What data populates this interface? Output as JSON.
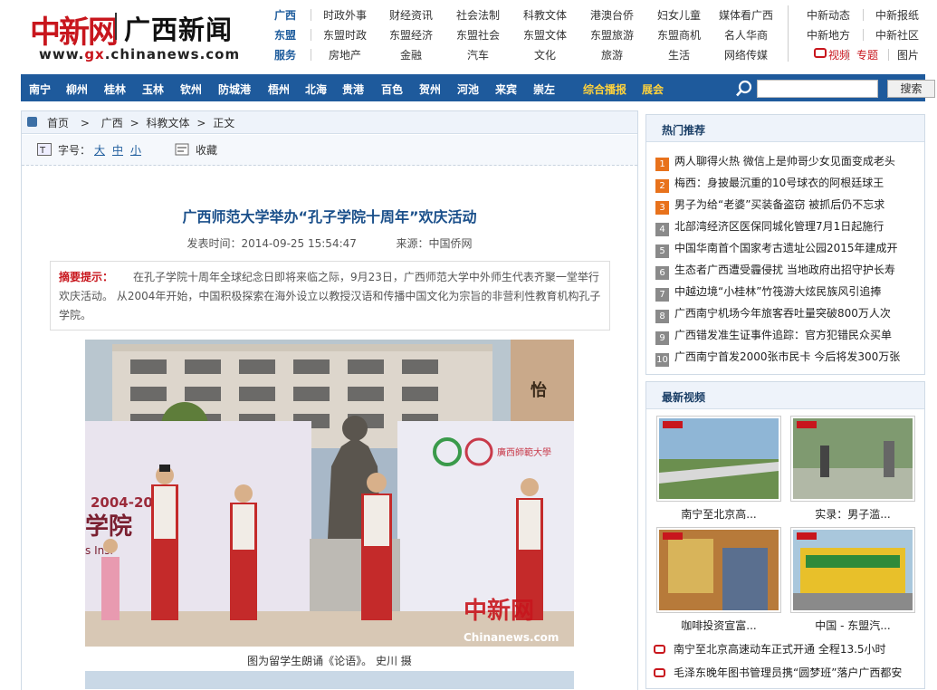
{
  "logo": {
    "part1": "中新网",
    "part2": "广西新闻",
    "domain_prefix": "www.",
    "domain_gx": "gx",
    "domain_suffix": ".chinanews.com"
  },
  "topnav": {
    "row1": [
      "广西",
      "时政外事",
      "财经资讯",
      "社会法制",
      "科教文体",
      "港澳台侨",
      "妇女儿童",
      "媒体看广西"
    ],
    "row2": [
      "东盟",
      "东盟时政",
      "东盟经济",
      "东盟社会",
      "东盟文体",
      "东盟旅游",
      "东盟商机",
      "名人华商"
    ],
    "row3": [
      "服务",
      "房地产",
      "金融",
      "汽车",
      "文化",
      "旅游",
      "生活",
      "网络传媒"
    ],
    "right1": [
      "中新动态",
      "中新报纸"
    ],
    "right2": [
      "中新地方",
      "中新社区"
    ],
    "right3": [
      "视频",
      "专题",
      "图片"
    ]
  },
  "cities": [
    "南宁",
    "柳州",
    "桂林",
    "玉林",
    "钦州",
    "防城港",
    "梧州",
    "北海",
    "贵港",
    "百色",
    "贺州",
    "河池",
    "来宾",
    "崇左"
  ],
  "nav_extra": [
    "综合播报",
    "展会"
  ],
  "search": {
    "placeholder": "",
    "button": "搜索"
  },
  "breadcrumb": [
    "首页",
    ">",
    "广西",
    ">",
    "科教文体",
    ">",
    "正文"
  ],
  "toolbar": {
    "font_label": "字号：",
    "big": "大",
    "mid": "中",
    "small": "小",
    "collect": "收藏"
  },
  "article": {
    "title": "广西师范大学举办“孔子学院十周年”欢庆活动",
    "date": "发表时间：2014-09-25 15:54:47",
    "source": "来源：中国侨网",
    "summary_label": "摘要提示：",
    "summary": "在孔子学院十周年全球纪念日即将来临之际，9月23日，广西师范大学中外师生代表齐聚一堂举行欢庆活动。  从2004年开始，中国积极探索在海外设立以教授汉语和传播中国文化为宗旨的非营利性教育机构孔子学院。",
    "caption": "图为留学生朗诵《论语》。    史川    摄",
    "photo": {
      "banner_year": "2004-201",
      "banner_text": "学院",
      "banner_en": "s Insi",
      "watermark_cn": "中新网",
      "watermark_en": "Chinanews.com",
      "pillar": "怡",
      "uni": "廣西師範大學"
    }
  },
  "hot": {
    "title": "热门推荐",
    "items": [
      "两人聊得火热 微信上是帅哥少女见面变成老头",
      "梅西：身披最沉重的10号球衣的阿根廷球王",
      "男子为给“老婆”买装备盗窃 被抓后仍不忘求",
      "北部湾经济区医保同城化管理7月1日起施行",
      "中国华南首个国家考古遗址公园2015年建成开",
      "生态者广西遭受霾侵扰 当地政府出招守护长寿",
      "中越边境“小桂林”竹筏游大炫民族风引追捧",
      "广西南宁机场今年旅客吞吐量突破800万人次",
      "广西错发准生证事件追踪：官方犯错民众买单",
      "广西南宁首发2000张市民卡 今后将发300万张"
    ],
    "num_colors": [
      "#e8721c",
      "#e8721c",
      "#e8721c",
      "#8a8a8a",
      "#8a8a8a",
      "#8a8a8a",
      "#8a8a8a",
      "#8a8a8a",
      "#8a8a8a",
      "#8a8a8a"
    ]
  },
  "videos": {
    "title": "最新视频",
    "items": [
      {
        "caption": "南宁至北京高..."
      },
      {
        "caption": "实录：男子滥..."
      },
      {
        "caption": "咖啡投资宣富..."
      },
      {
        "caption": "中国 - 东盟汽..."
      }
    ],
    "links": [
      "南宁至北京高速动车正式开通 全程13.5小时",
      "毛泽东晚年图书管理员携“圆梦班”落户广西都安"
    ]
  },
  "colors": {
    "nav_bg": "#1e5a9c",
    "brand_red": "#c8161d",
    "title_blue": "#1a4f8a"
  }
}
